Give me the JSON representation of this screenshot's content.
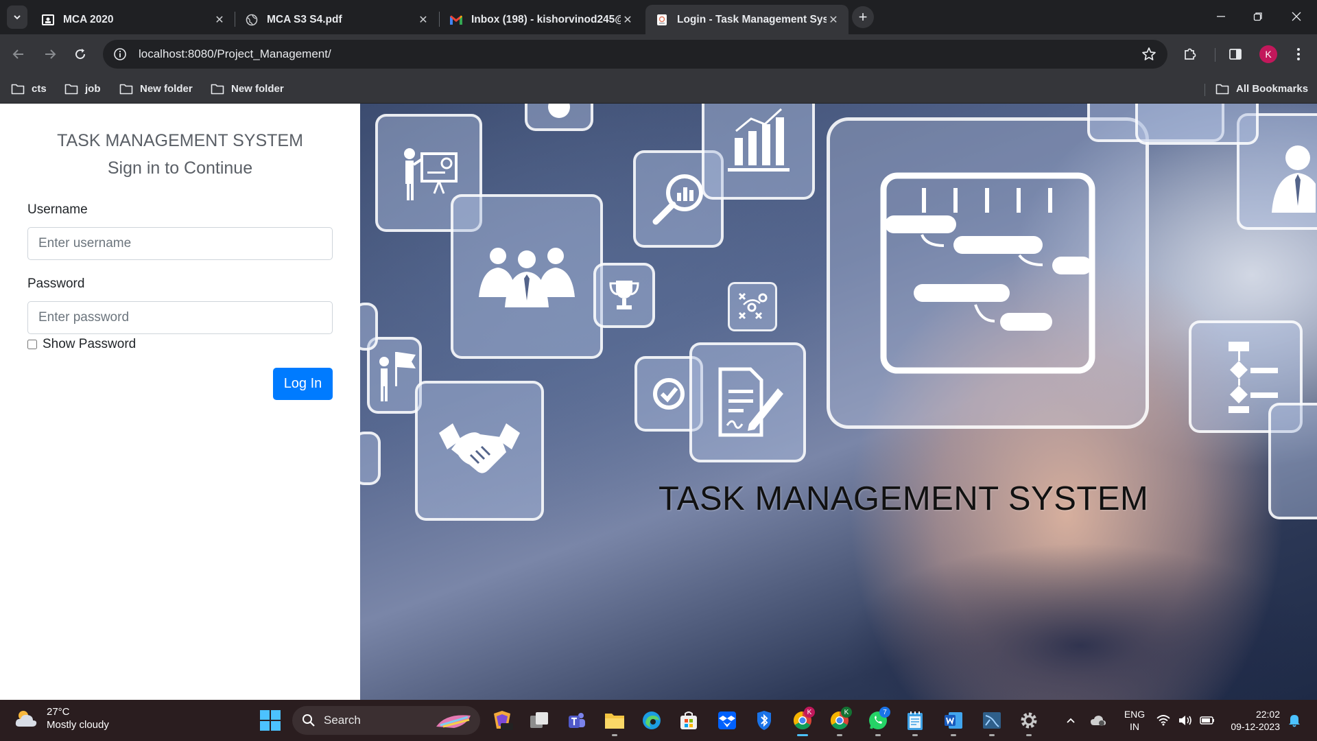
{
  "browser": {
    "tabs": [
      {
        "title": "MCA 2020",
        "icon": "classroom-icon",
        "active": false
      },
      {
        "title": "MCA S3 S4.pdf",
        "icon": "globe-icon",
        "active": false
      },
      {
        "title": "Inbox (198) - kishorvinod245@",
        "icon": "gmail-icon",
        "active": false
      },
      {
        "title": "Login - Task Management Syst",
        "icon": "page-icon",
        "active": true
      }
    ],
    "url": "localhost:8080/Project_Management/",
    "profile_initial": "K",
    "bookmarks": [
      "cts",
      "job",
      "New folder",
      "New folder"
    ],
    "all_bookmarks": "All Bookmarks"
  },
  "login": {
    "title": "TASK MANAGEMENT SYSTEM",
    "subtitle": "Sign in to Continue",
    "username_label": "Username",
    "username_placeholder": "Enter username",
    "password_label": "Password",
    "password_placeholder": "Enter password",
    "show_password": "Show Password",
    "login_button": "Log In"
  },
  "hero": {
    "title": "TASK MANAGEMENT SYSTEM"
  },
  "taskbar": {
    "weather_temp": "27°C",
    "weather_desc": "Mostly cloudy",
    "search_label": "Search",
    "chrome_badge_1": "K",
    "chrome_badge_2": "K",
    "whatsapp_badge": "7",
    "lang_1": "ENG",
    "lang_2": "IN",
    "time": "22:02",
    "date": "09-12-2023"
  },
  "colors": {
    "accent": "#007bff",
    "tabbar": "#1f2023",
    "toolbar": "#35363a",
    "taskbar": "#2a1d1f",
    "profile": "#c2185b"
  }
}
